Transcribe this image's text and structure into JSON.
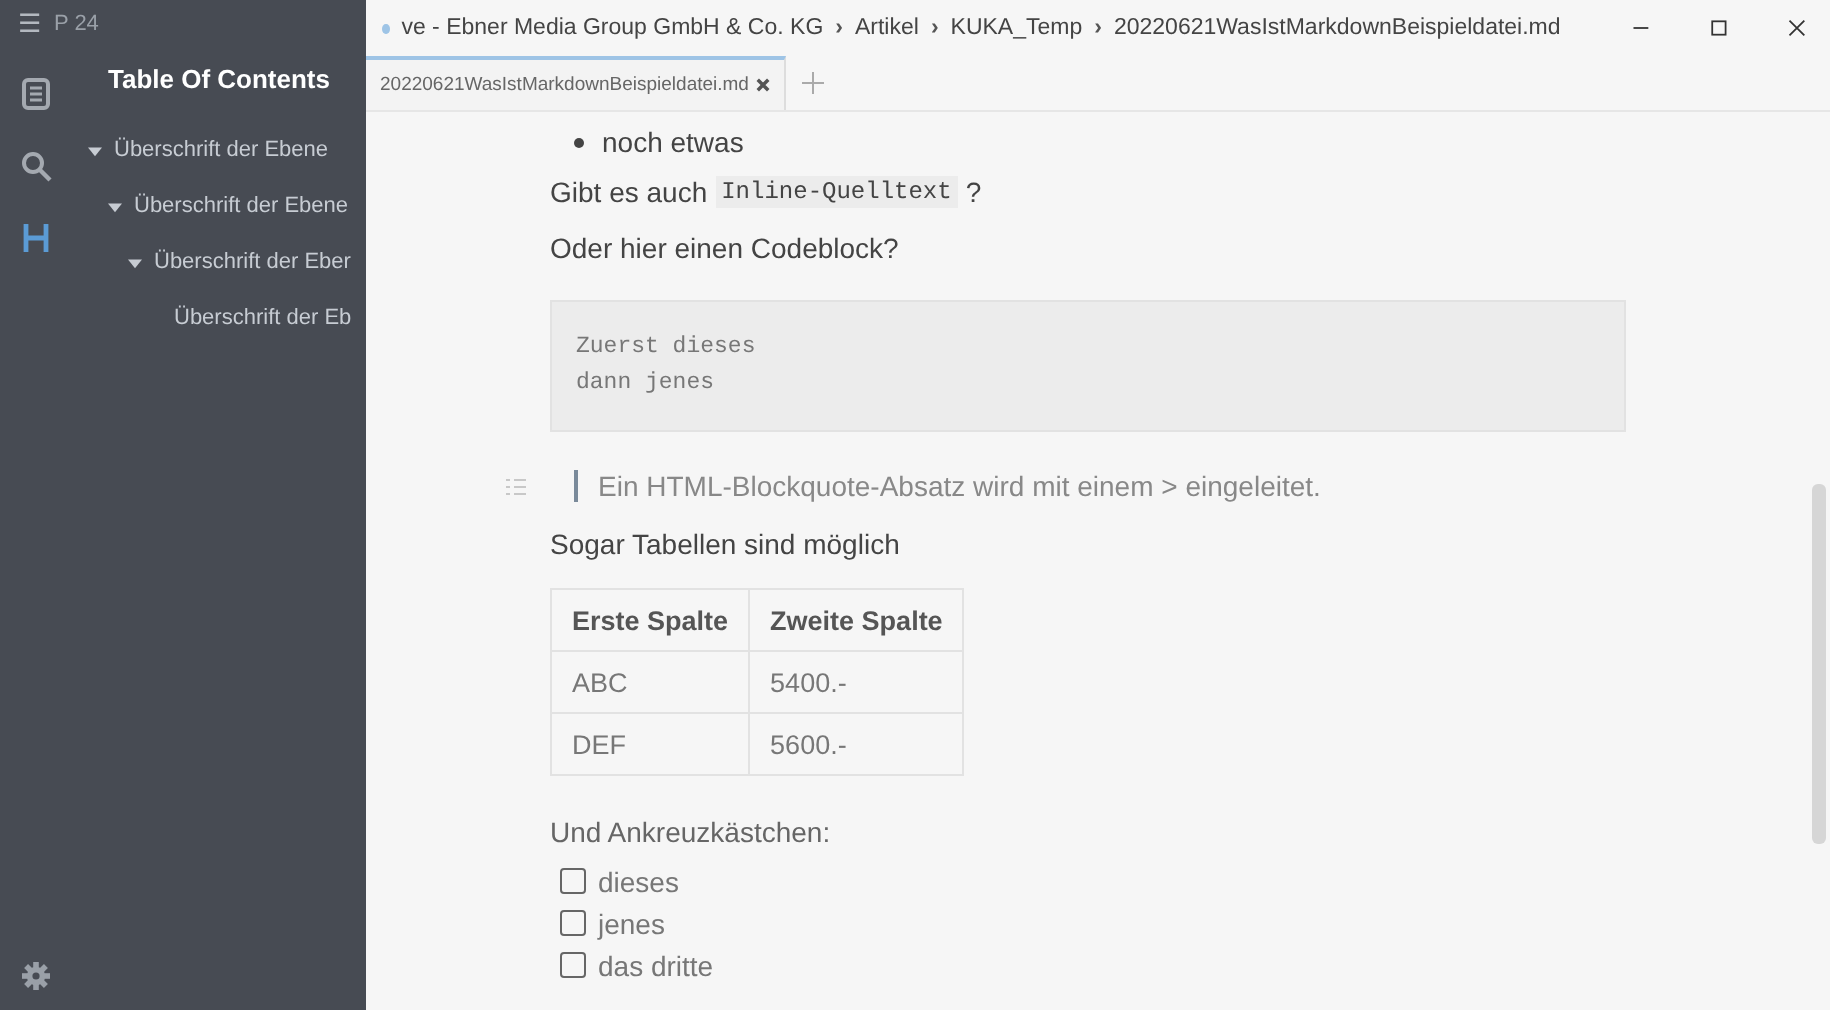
{
  "sidebar": {
    "menu_glyph": "☰",
    "word_count": "P 24",
    "title": "Table Of Contents",
    "toc": [
      {
        "text": "Überschrift der Ebene",
        "expanded": true,
        "children": [
          {
            "text": "Überschrift der Ebene",
            "expanded": true,
            "children": [
              {
                "text": "Überschrift der Eber",
                "expanded": true,
                "children": [
                  {
                    "text": "Überschrift der Eb"
                  }
                ]
              }
            ]
          }
        ]
      }
    ],
    "tool_icons": [
      {
        "kind": "files",
        "selected": false
      },
      {
        "kind": "search",
        "selected": false
      },
      {
        "kind": "outline",
        "selected": true
      }
    ]
  },
  "window": {
    "separator": "›",
    "breadcrumb": [
      "ve - Ebner Media Group GmbH & Co. KG",
      "Artikel",
      "KUKA_Temp",
      "20220621WasIstMarkdownBeispieldatei.md"
    ]
  },
  "tabs": [
    {
      "label": "20220621WasIstMarkdownBeispieldatei.md",
      "selected": true
    }
  ],
  "document": {
    "bullet": "noch etwas",
    "inline_before": "Gibt es auch",
    "inline_code": "Inline-Quelltext",
    "inline_after": "?",
    "codeblock_intro": "Oder hier einen Codeblock?",
    "code_lines": [
      "Zuerst dieses",
      "dann jenes"
    ],
    "blockquote": "Ein HTML-Blockquote-Absatz wird mit einem > eingeleitet.",
    "table_intro": "Sogar Tabellen sind möglich",
    "table": {
      "columns": [
        "Erste Spalte",
        "Zweite Spalte"
      ],
      "rows": [
        [
          "ABC",
          "5400.-"
        ],
        [
          "DEF",
          "5600.-"
        ]
      ]
    },
    "checklist_intro": "Und Ankreuzkästchen:",
    "checklist": [
      {
        "label": "dieses",
        "checked": false
      },
      {
        "label": "jenes",
        "checked": false
      },
      {
        "label": "das dritte",
        "checked": false
      }
    ]
  }
}
